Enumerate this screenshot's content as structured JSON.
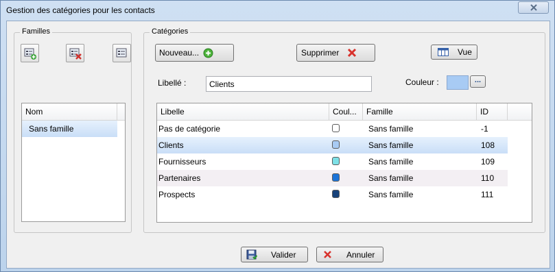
{
  "window": {
    "title": "Gestion des catégories pour les contacts"
  },
  "icons": {
    "close": "close-icon"
  },
  "familles": {
    "legend": "Familles",
    "add_icon": "add-family-icon",
    "delete_icon": "delete-family-icon",
    "edit_icon": "edit-family-icon",
    "column_header": "Nom",
    "items": [
      {
        "label": "Sans famille",
        "selected": true
      }
    ]
  },
  "categories": {
    "legend": "Catégories",
    "new_button": "Nouveau...",
    "delete_button": "Supprimer",
    "view_button": "Vue",
    "libelle_label": "Libellé :",
    "libelle_value": "Clients",
    "couleur_label": "Couleur :",
    "couleur_value": "#a8cbf4",
    "couleur_browse": "...",
    "columns": [
      "Libelle",
      "Coul...",
      "Famille",
      "ID"
    ],
    "rows": [
      {
        "libelle": "Pas de catégorie",
        "color": "#ffffff",
        "famille": "Sans famille",
        "id": "-1"
      },
      {
        "libelle": "Clients",
        "color": "#a8cbf4",
        "famille": "Sans famille",
        "id": "108"
      },
      {
        "libelle": "Fournisseurs",
        "color": "#7de0e6",
        "famille": "Sans famille",
        "id": "109"
      },
      {
        "libelle": "Partenaires",
        "color": "#1c74d8",
        "famille": "Sans famille",
        "id": "110"
      },
      {
        "libelle": "Prospects",
        "color": "#17427a",
        "famille": "Sans famille",
        "id": "111"
      }
    ]
  },
  "footer": {
    "ok_button": "Valider",
    "cancel_button": "Annuler"
  }
}
